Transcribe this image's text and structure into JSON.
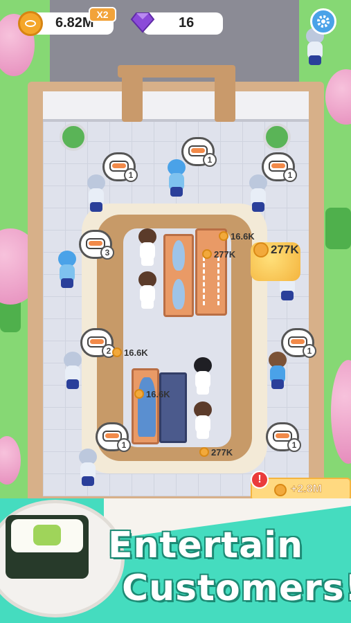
{
  "hud": {
    "coins": "6.82M",
    "multiplier": "X2",
    "gems": "16",
    "coin_icon": "coin-icon",
    "gem_icon": "gem-icon",
    "settings_icon": "gear-icon"
  },
  "orders": [
    {
      "count": "1"
    },
    {
      "count": "1"
    },
    {
      "count": "1"
    },
    {
      "count": "3"
    },
    {
      "count": "2"
    },
    {
      "count": "1"
    },
    {
      "count": "1"
    },
    {
      "count": "1"
    }
  ],
  "coin_labels": {
    "belt_top": "16.6K",
    "belt_mid": "277K",
    "big_stack": "277K",
    "left_upper": "16.6K",
    "left_lower": "16.6K",
    "bottom": "277K"
  },
  "income": {
    "alert": "!",
    "amount": "+2.8M"
  },
  "banner": {
    "line1": "Entertain",
    "line2": "Customers!"
  },
  "colors": {
    "accent_teal": "#45dcbf",
    "coin_gold": "#f4a62a",
    "gem_purple": "#8b4ad9",
    "settings_blue": "#4aa2e8"
  }
}
